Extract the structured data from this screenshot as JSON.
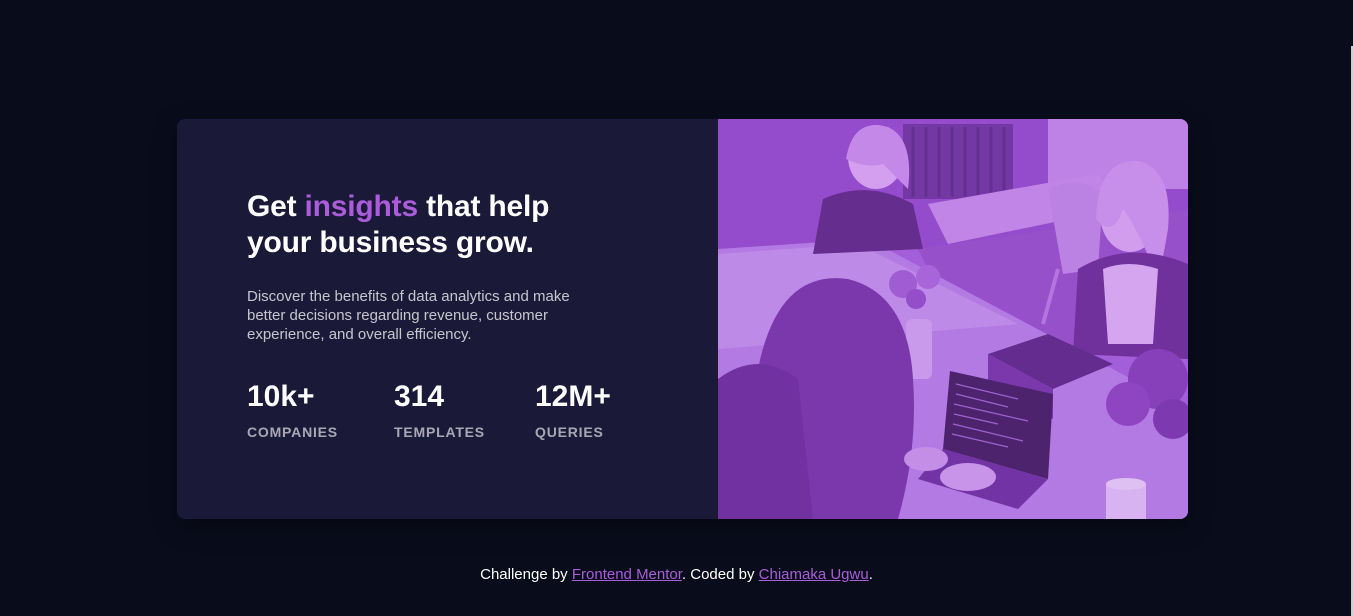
{
  "card": {
    "heading_pre": "Get ",
    "heading_accent": "insights",
    "heading_post": " that help your business grow.",
    "description": "Discover the benefits of data analytics and make better decisions regarding revenue, customer experience, and overall efficiency.",
    "stats": [
      {
        "value": "10k+",
        "label": "COMPANIES"
      },
      {
        "value": "314",
        "label": "TEMPLATES"
      },
      {
        "value": "12M+",
        "label": "QUERIES"
      }
    ]
  },
  "footer": {
    "prefix": "Challenge by ",
    "link1": "Frontend Mentor",
    "middle": ". Coded by ",
    "link2": "Chiamaka Ugwu",
    "suffix": "."
  },
  "colors": {
    "background": "#090c1b",
    "card": "#1b1938",
    "accent": "#aa5cdb",
    "image_tint": "#9b4ed5"
  }
}
